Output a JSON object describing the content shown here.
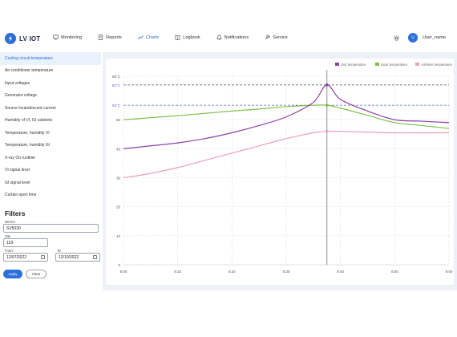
{
  "app": {
    "name": "LV IOT"
  },
  "nav": [
    {
      "label": "Monitoring",
      "icon": "monitoring-icon"
    },
    {
      "label": "Reports",
      "icon": "reports-icon"
    },
    {
      "label": "Charts",
      "icon": "charts-icon"
    },
    {
      "label": "Logbook",
      "icon": "book-icon"
    },
    {
      "label": "Notifications",
      "icon": "bell-icon"
    },
    {
      "label": "Service",
      "icon": "wrench-icon"
    }
  ],
  "active_nav": "Charts",
  "user": {
    "initials": "U",
    "name": "User_name"
  },
  "sidebar": {
    "items": [
      "Cooling circuit temperature",
      "Air conditioner temperature",
      "Input voltages",
      "Generator voltage",
      "Source incandescent current",
      "Humidity of VI, GI cabinets",
      "Temperature, humidity VI",
      "Temperature, humidity GI",
      "X-ray On runtime",
      "VI signal level",
      "GI signal level",
      "Curtain open time"
    ],
    "active_index": 0
  },
  "filters": {
    "title": "Filters",
    "device_label": "Device",
    "device_value": "SV5030",
    "site_label": "Site",
    "site_value": "123",
    "from_label": "From:",
    "from_value": "12/07/2022",
    "to_label": "To:",
    "to_value": "12/10/2022",
    "apply_label": "Apply",
    "clear_label": "Clear"
  },
  "colors": {
    "accent": "#2b6fd9",
    "unit_temp": "#8e3fa8",
    "input_temp": "#7cc24a",
    "ambient_temp": "#eea0b4",
    "threshold_high": "#7b4bbf",
    "threshold_low": "#5c6cd6"
  },
  "chart_data": {
    "type": "line",
    "x_labels": [
      "8:00",
      "8:10",
      "8:20",
      "8:30",
      "8:40",
      "8:50",
      "9:00"
    ],
    "x": [
      0,
      5,
      10,
      15,
      20,
      25,
      30,
      35,
      37.5,
      40,
      45,
      50,
      55,
      60
    ],
    "ylim": [
      0,
      65
    ],
    "yticks": [
      "0",
      "10",
      "20",
      "30",
      "40",
      "50",
      "65°C"
    ],
    "series": [
      {
        "name": "Unit temperature",
        "color": "#8e3fa8",
        "values": [
          40,
          41,
          42,
          43.5,
          45.5,
          48,
          51,
          56,
          62,
          57,
          53,
          50,
          49.5,
          49
        ]
      },
      {
        "name": "Input temperature",
        "color": "#7cc24a",
        "values": [
          50,
          50.7,
          51.4,
          52.2,
          53,
          53.7,
          54.5,
          55,
          55,
          54,
          51.5,
          49,
          48,
          47
        ]
      },
      {
        "name": "Ambient temperature",
        "color": "#eea0b4",
        "values": [
          30,
          31.5,
          33.5,
          36,
          38.5,
          41,
          43.5,
          45.5,
          46,
          46,
          45.7,
          45.5,
          45.5,
          45.5
        ]
      }
    ],
    "thresholds": [
      {
        "label": "62°C",
        "value": 62,
        "color": "#7b4bbf"
      },
      {
        "label": "55°C",
        "value": 55,
        "color": "#5c6cd6"
      }
    ],
    "cursor_x": 37.5,
    "grid": true,
    "legend": "top-right"
  }
}
